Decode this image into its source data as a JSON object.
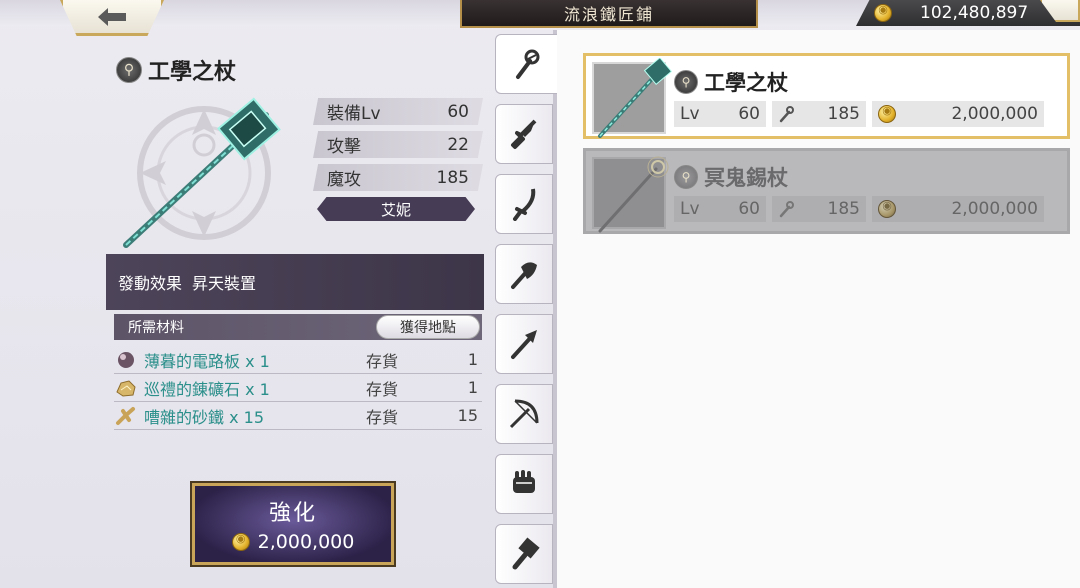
{
  "header": {
    "shop_title": "流浪鐵匠鋪",
    "currency_amount": "102,480,897"
  },
  "detail": {
    "item_name": "工學之杖",
    "stats": [
      {
        "label": "裝備Lv",
        "value": "60"
      },
      {
        "label": "攻擊",
        "value": "22"
      },
      {
        "label": "魔攻",
        "value": "185"
      }
    ],
    "owner": "艾妮",
    "effect_label": "發動效果",
    "effect_value": "昇天裝置"
  },
  "materials": {
    "header_label": "所需材料",
    "source_button": "獲得地點",
    "items": [
      {
        "name": "薄暮的電路板",
        "qty": "x 1",
        "stock_label": "存貨",
        "stock": "1",
        "icon": "orb-icon"
      },
      {
        "name": "巡禮的錬礦石",
        "qty": "x 1",
        "stock_label": "存貨",
        "stock": "1",
        "icon": "ore-icon"
      },
      {
        "name": "嘈雜的砂鐵",
        "qty": "x 15",
        "stock_label": "存貨",
        "stock": "15",
        "icon": "iron-sand-icon"
      }
    ]
  },
  "enhance": {
    "label": "強化",
    "cost": "2,000,000"
  },
  "tabs": [
    "staff-icon",
    "sword-icon",
    "katana-icon",
    "axe-icon",
    "spear-icon",
    "bow-icon",
    "fist-icon",
    "hammer-icon"
  ],
  "weapons": [
    {
      "name": "工學之杖",
      "lv_label": "Lv",
      "lv": "60",
      "atk": "185",
      "price": "2,000,000",
      "state": "selected"
    },
    {
      "name": "冥鬼錫杖",
      "lv_label": "Lv",
      "lv": "60",
      "atk": "185",
      "price": "2,000,000",
      "state": "disabled"
    }
  ],
  "colors": {
    "accent_gold": "#e3bf68",
    "material_teal": "#2a8f8a",
    "panel_purple": "#463c55"
  }
}
